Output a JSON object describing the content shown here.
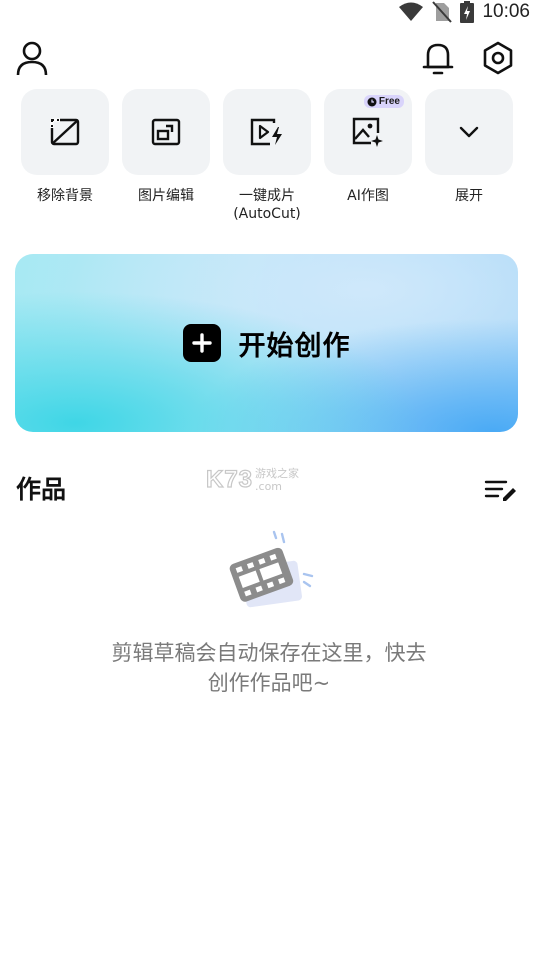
{
  "status_bar": {
    "time": "10:06"
  },
  "tools": [
    {
      "label": "移除背景",
      "icon": "remove-background-icon"
    },
    {
      "label": "图片编辑",
      "icon": "image-edit-icon"
    },
    {
      "label": "一键成片\n(AutoCut)",
      "icon": "autocut-icon"
    },
    {
      "label": "AI作图",
      "icon": "ai-image-icon",
      "badge": "Free"
    },
    {
      "label": "展开",
      "icon": "chevron-down-icon"
    }
  ],
  "create": {
    "label": "开始创作"
  },
  "works": {
    "title": "作品"
  },
  "watermark": {
    "logo": "K73",
    "line1": "游戏之家",
    "line2": ".com"
  },
  "empty_state": {
    "message_line1": "剪辑草稿会自动保存在这里，快去",
    "message_line2": "创作作品吧~"
  }
}
